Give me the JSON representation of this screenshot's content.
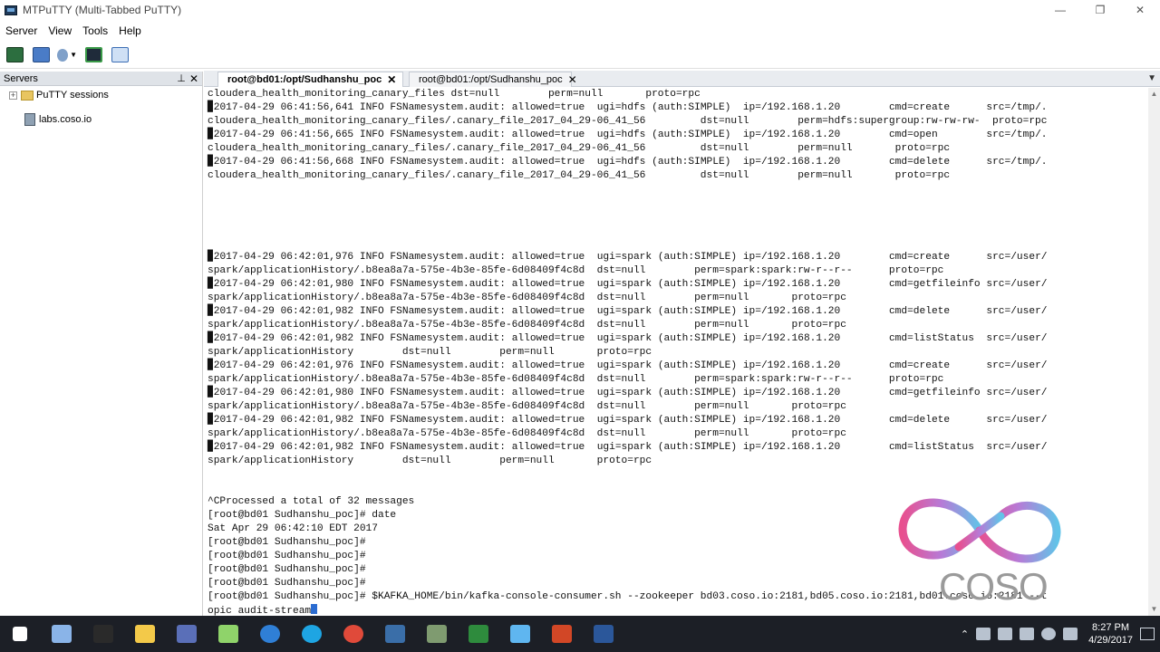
{
  "window": {
    "title": "MTPuTTY (Multi-Tabbed PuTTY)",
    "controls": [
      "—",
      "❐",
      "✕"
    ]
  },
  "menu": [
    "Server",
    "View",
    "Tools",
    "Help"
  ],
  "servers_panel": {
    "title": "Servers",
    "pin": "📌",
    "close": "✕",
    "items": [
      {
        "label": "PuTTY sessions",
        "icon": "folder-icon"
      },
      {
        "label": "labs.coso.io",
        "icon": "server-icon"
      }
    ]
  },
  "tabs": [
    {
      "label": "root@bd01:/opt/Sudhanshu_poc",
      "active": true
    },
    {
      "label": "root@bd01:/opt/Sudhanshu_poc",
      "active": false
    }
  ],
  "terminal": {
    "lines": [
      "cloudera_health_monitoring_canary_files dst=null        perm=null       proto=rpc",
      "▉2017-04-29 06:41:56,641 INFO FSNamesystem.audit: allowed=true  ugi=hdfs (auth:SIMPLE)  ip=/192.168.1.20        cmd=create      src=/tmp/.",
      "cloudera_health_monitoring_canary_files/.canary_file_2017_04_29-06_41_56         dst=null        perm=hdfs:supergroup:rw-rw-rw-  proto=rpc",
      "▉2017-04-29 06:41:56,665 INFO FSNamesystem.audit: allowed=true  ugi=hdfs (auth:SIMPLE)  ip=/192.168.1.20        cmd=open        src=/tmp/.",
      "cloudera_health_monitoring_canary_files/.canary_file_2017_04_29-06_41_56         dst=null        perm=null       proto=rpc",
      "▉2017-04-29 06:41:56,668 INFO FSNamesystem.audit: allowed=true  ugi=hdfs (auth:SIMPLE)  ip=/192.168.1.20        cmd=delete      src=/tmp/.",
      "cloudera_health_monitoring_canary_files/.canary_file_2017_04_29-06_41_56         dst=null        perm=null       proto=rpc",
      "",
      "",
      "",
      "",
      "",
      "▉2017-04-29 06:42:01,976 INFO FSNamesystem.audit: allowed=true  ugi=spark (auth:SIMPLE) ip=/192.168.1.20        cmd=create      src=/user/",
      "spark/applicationHistory/.b8ea8a7a-575e-4b3e-85fe-6d08409f4c8d  dst=null        perm=spark:spark:rw-r--r--      proto=rpc",
      "▉2017-04-29 06:42:01,980 INFO FSNamesystem.audit: allowed=true  ugi=spark (auth:SIMPLE) ip=/192.168.1.20        cmd=getfileinfo src=/user/",
      "spark/applicationHistory/.b8ea8a7a-575e-4b3e-85fe-6d08409f4c8d  dst=null        perm=null       proto=rpc",
      "▉2017-04-29 06:42:01,982 INFO FSNamesystem.audit: allowed=true  ugi=spark (auth:SIMPLE) ip=/192.168.1.20        cmd=delete      src=/user/",
      "spark/applicationHistory/.b8ea8a7a-575e-4b3e-85fe-6d08409f4c8d  dst=null        perm=null       proto=rpc",
      "▉2017-04-29 06:42:01,982 INFO FSNamesystem.audit: allowed=true  ugi=spark (auth:SIMPLE) ip=/192.168.1.20        cmd=listStatus  src=/user/",
      "spark/applicationHistory        dst=null        perm=null       proto=rpc",
      "▉2017-04-29 06:42:01,976 INFO FSNamesystem.audit: allowed=true  ugi=spark (auth:SIMPLE) ip=/192.168.1.20        cmd=create      src=/user/",
      "spark/applicationHistory/.b8ea8a7a-575e-4b3e-85fe-6d08409f4c8d  dst=null        perm=spark:spark:rw-r--r--      proto=rpc",
      "▉2017-04-29 06:42:01,980 INFO FSNamesystem.audit: allowed=true  ugi=spark (auth:SIMPLE) ip=/192.168.1.20        cmd=getfileinfo src=/user/",
      "spark/applicationHistory/.b8ea8a7a-575e-4b3e-85fe-6d08409f4c8d  dst=null        perm=null       proto=rpc",
      "▉2017-04-29 06:42:01,982 INFO FSNamesystem.audit: allowed=true  ugi=spark (auth:SIMPLE) ip=/192.168.1.20        cmd=delete      src=/user/",
      "spark/applicationHistory/.b8ea8a7a-575e-4b3e-85fe-6d08409f4c8d  dst=null        perm=null       proto=rpc",
      "▉2017-04-29 06:42:01,982 INFO FSNamesystem.audit: allowed=true  ugi=spark (auth:SIMPLE) ip=/192.168.1.20        cmd=listStatus  src=/user/",
      "spark/applicationHistory        dst=null        perm=null       proto=rpc",
      "",
      "",
      "^CProcessed a total of 32 messages",
      "[root@bd01 Sudhanshu_poc]# date",
      "Sat Apr 29 06:42:10 EDT 2017",
      "[root@bd01 Sudhanshu_poc]#",
      "[root@bd01 Sudhanshu_poc]#",
      "[root@bd01 Sudhanshu_poc]#",
      "[root@bd01 Sudhanshu_poc]#",
      "[root@bd01 Sudhanshu_poc]# $KAFKA_HOME/bin/kafka-console-consumer.sh --zookeeper bd03.coso.io:2181,bd05.coso.io:2181,bd01.coso.io:2181 --t",
      "opic audit-stream"
    ]
  },
  "logo": {
    "text": "COSO IT",
    "colors": [
      "#e8508f",
      "#b77ad6",
      "#62c3e8"
    ]
  },
  "taskbar": {
    "apps": [
      {
        "name": "windows-start-icon",
        "color": "#ffffff"
      },
      {
        "name": "network-icon",
        "color": "#8ab4e8"
      },
      {
        "name": "terminal-icon",
        "color": "#2a2a2a"
      },
      {
        "name": "file-explorer-icon",
        "color": "#f3c949"
      },
      {
        "name": "mobaxterm-icon",
        "color": "#5a6fb8"
      },
      {
        "name": "notepad-plus-icon",
        "color": "#8fd36a"
      },
      {
        "name": "edge-icon",
        "color": "#2f7fd6"
      },
      {
        "name": "skype-icon",
        "color": "#1ea5e3"
      },
      {
        "name": "chrome-icon",
        "color": "#e04a3a"
      },
      {
        "name": "mtputty-icon",
        "color": "#3a6ea8"
      },
      {
        "name": "vm-icon",
        "color": "#7f9b70"
      },
      {
        "name": "excel-icon",
        "color": "#2e8b3d"
      },
      {
        "name": "snowflake-icon",
        "color": "#5fb6f0"
      },
      {
        "name": "powerpoint-icon",
        "color": "#d24726"
      },
      {
        "name": "word-icon",
        "color": "#2b579a"
      }
    ],
    "time": "8:27 PM",
    "date": "4/29/2017"
  }
}
